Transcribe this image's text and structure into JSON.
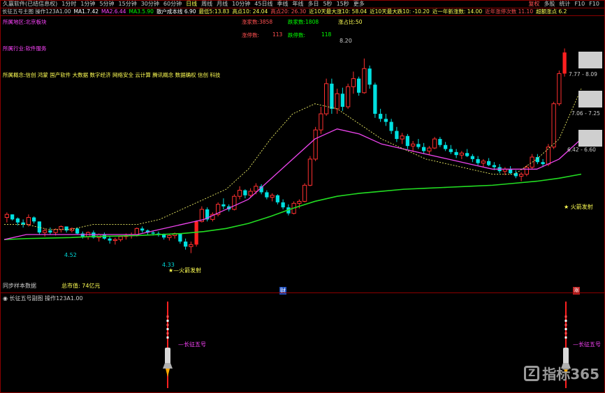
{
  "app": {
    "title": "久赢软件(已结信息权)"
  },
  "toolbar": {
    "periods": [
      "1分时",
      "1分钟",
      "5分钟",
      "15分钟",
      "30分钟",
      "60分钟",
      "日线",
      "周线",
      "月线",
      "10分钟",
      "45日线",
      "季线",
      "年线",
      "多日",
      "5秒",
      "15秒",
      "更多"
    ],
    "active_index": 6,
    "right_items": [
      "复权",
      "多股",
      "统计",
      "F10",
      "F10"
    ]
  },
  "info": {
    "items": [
      {
        "text": "长征五号主图  操作123A1.00",
        "color": "#cccccc"
      },
      {
        "text": "MA1.7.42",
        "color": "#ffffff"
      },
      {
        "text": "MA2.6.44",
        "color": "#ff44ff"
      },
      {
        "text": "MA3.5.90",
        "color": "#00ff00"
      },
      {
        "text": "散户成本线 6.90",
        "color": "#ffffff"
      },
      {
        "text": "最低5:13.83",
        "color": "#ffff54"
      },
      {
        "text": "高点10: 24.04",
        "color": "#ffff54"
      },
      {
        "text": "高点20: 26.30",
        "color": "#ff5050"
      },
      {
        "text": "近10天最大涨10: 58.04",
        "color": "#ffff54"
      },
      {
        "text": "近10天最大跌10: -10.20",
        "color": "#ffff54"
      },
      {
        "text": "近一年新涨数: 14.00",
        "color": "#ffff54"
      },
      {
        "text": "近年涨停次数 11.10",
        "color": "#ff5050"
      },
      {
        "text": "超额涨点 6.2",
        "color": "#ffff54"
      }
    ]
  },
  "left_labels": [
    {
      "text": "所属地区:北京板块",
      "color": "#ff44ff"
    },
    {
      "text": "所属行业:软件服务",
      "color": "#ff44ff"
    },
    {
      "text": "所属概念:信创 鸿蒙 国产软件 大数据 数字经济 网络安全 云计算 腾讯概念 数据确权 信创 科技",
      "color": "#ffff54"
    }
  ],
  "stats": [
    {
      "text": "涨家数:3858",
      "color": "#ff5050"
    },
    {
      "text": "跌家数:1808",
      "color": "#00ff00"
    },
    {
      "text": "涨占比:50",
      "color": "#ffff54"
    },
    {
      "text": "涨停数:",
      "color": "#ff5050"
    },
    {
      "text": "113",
      "color": "#ff5050"
    },
    {
      "text": "跌停数:",
      "color": "#00ff00"
    },
    {
      "text": "118",
      "color": "#00ff00"
    }
  ],
  "annotations": {
    "high": "8.20",
    "low_left": "4.52",
    "low_mid": "4.33",
    "rocket_left": "火箭发射",
    "rocket_right": "火箭发射",
    "bottom_left": "同步样本数据",
    "bottom_mid": "总市值: 74亿元",
    "marker_mid": "财",
    "marker_right": "涨"
  },
  "price_boxes": [
    {
      "label": "7.77 - 8.09"
    },
    {
      "label": "7.06 - 7.25"
    },
    {
      "label": "6.42 - 6.60"
    }
  ],
  "subchart": {
    "title": "长征五号副图  操作123A1.00",
    "signal_label": "长征五号"
  },
  "logo": {
    "text": "指标365"
  },
  "chart_data": {
    "type": "candlestick",
    "ylim": [
      4.2,
      8.6
    ],
    "candles": [
      [
        5.04,
        5.14,
        4.94,
        5.1
      ],
      [
        5.1,
        5.1,
        4.98,
        5.0
      ],
      [
        5.02,
        5.04,
        4.88,
        4.94
      ],
      [
        4.94,
        5.0,
        4.84,
        4.9
      ],
      [
        4.9,
        5.1,
        4.86,
        5.04
      ],
      [
        5.04,
        5.06,
        4.92,
        4.96
      ],
      [
        4.96,
        4.96,
        4.7,
        4.74
      ],
      [
        4.74,
        4.82,
        4.66,
        4.78
      ],
      [
        4.78,
        4.84,
        4.7,
        4.74
      ],
      [
        4.74,
        4.82,
        4.68,
        4.8
      ],
      [
        4.8,
        4.88,
        4.74,
        4.86
      ],
      [
        4.86,
        4.86,
        4.74,
        4.78
      ],
      [
        4.78,
        4.84,
        4.74,
        4.82
      ],
      [
        4.82,
        4.84,
        4.7,
        4.72
      ],
      [
        4.72,
        4.76,
        4.62,
        4.66
      ],
      [
        4.66,
        4.76,
        4.6,
        4.74
      ],
      [
        4.74,
        4.78,
        4.62,
        4.64
      ],
      [
        4.64,
        4.72,
        4.56,
        4.7
      ],
      [
        4.7,
        4.74,
        4.6,
        4.62
      ],
      [
        4.62,
        4.66,
        4.52,
        4.58
      ],
      [
        4.58,
        4.64,
        4.5,
        4.6
      ],
      [
        4.6,
        4.68,
        4.56,
        4.66
      ],
      [
        4.66,
        4.72,
        4.6,
        4.68
      ],
      [
        4.68,
        4.74,
        4.62,
        4.7
      ],
      [
        4.7,
        4.84,
        4.66,
        4.82
      ],
      [
        4.82,
        4.86,
        4.74,
        4.78
      ],
      [
        4.78,
        4.8,
        4.7,
        4.74
      ],
      [
        4.74,
        4.78,
        4.68,
        4.72
      ],
      [
        4.72,
        4.76,
        4.66,
        4.7
      ],
      [
        4.7,
        4.72,
        4.6,
        4.64
      ],
      [
        4.64,
        4.7,
        4.58,
        4.68
      ],
      [
        4.68,
        4.74,
        4.62,
        4.72
      ],
      [
        4.72,
        4.72,
        4.52,
        4.56
      ],
      [
        4.56,
        4.62,
        4.4,
        4.46
      ],
      [
        4.46,
        4.56,
        4.33,
        4.5
      ],
      [
        4.5,
        4.98,
        4.46,
        4.96
      ],
      [
        4.96,
        5.26,
        4.94,
        5.2
      ],
      [
        5.2,
        5.24,
        4.96,
        5.0
      ],
      [
        5.0,
        5.14,
        4.96,
        5.1
      ],
      [
        5.1,
        5.34,
        5.06,
        5.3
      ],
      [
        5.3,
        5.42,
        5.2,
        5.26
      ],
      [
        5.26,
        5.3,
        5.16,
        5.2
      ],
      [
        5.2,
        5.5,
        5.18,
        5.46
      ],
      [
        5.46,
        5.66,
        5.4,
        5.58
      ],
      [
        5.58,
        5.6,
        5.42,
        5.48
      ],
      [
        5.48,
        5.62,
        5.44,
        5.56
      ],
      [
        5.56,
        5.72,
        5.5,
        5.66
      ],
      [
        5.66,
        5.7,
        5.5,
        5.54
      ],
      [
        5.54,
        5.58,
        5.4,
        5.44
      ],
      [
        5.44,
        5.52,
        5.36,
        5.48
      ],
      [
        5.48,
        5.5,
        5.3,
        5.34
      ],
      [
        5.34,
        5.4,
        5.2,
        5.24
      ],
      [
        5.24,
        5.3,
        5.08,
        5.12
      ],
      [
        5.12,
        5.36,
        5.1,
        5.32
      ],
      [
        5.32,
        5.4,
        5.22,
        5.36
      ],
      [
        5.36,
        5.72,
        5.34,
        5.68
      ],
      [
        5.68,
        6.26,
        5.66,
        6.2
      ],
      [
        6.2,
        6.84,
        6.16,
        6.78
      ],
      [
        6.78,
        7.24,
        6.7,
        7.1
      ],
      [
        7.1,
        7.8,
        7.06,
        7.7
      ],
      [
        7.7,
        7.8,
        7.1,
        7.2
      ],
      [
        7.2,
        7.6,
        7.1,
        7.5
      ],
      [
        7.5,
        7.62,
        7.16,
        7.24
      ],
      [
        7.24,
        7.7,
        7.2,
        7.64
      ],
      [
        7.64,
        7.94,
        7.5,
        7.8
      ],
      [
        7.8,
        7.84,
        7.46,
        7.52
      ],
      [
        7.52,
        8.2,
        7.5,
        8.0
      ],
      [
        8.0,
        8.06,
        7.6,
        7.68
      ],
      [
        7.68,
        7.72,
        7.02,
        7.1
      ],
      [
        7.1,
        7.2,
        6.94,
        7.0
      ],
      [
        7.0,
        7.1,
        6.86,
        6.94
      ],
      [
        6.94,
        7.0,
        6.7,
        6.76
      ],
      [
        6.76,
        6.84,
        6.54,
        6.6
      ],
      [
        6.6,
        6.72,
        6.5,
        6.66
      ],
      [
        6.66,
        6.7,
        6.4,
        6.46
      ],
      [
        6.46,
        6.56,
        6.34,
        6.5
      ],
      [
        6.5,
        6.6,
        6.4,
        6.44
      ],
      [
        6.44,
        6.52,
        6.3,
        6.36
      ],
      [
        6.36,
        6.46,
        6.28,
        6.42
      ],
      [
        6.42,
        6.64,
        6.4,
        6.6
      ],
      [
        6.6,
        6.64,
        6.44,
        6.48
      ],
      [
        6.48,
        6.54,
        6.36,
        6.4
      ],
      [
        6.4,
        6.48,
        6.3,
        6.34
      ],
      [
        6.34,
        6.4,
        6.22,
        6.28
      ],
      [
        6.28,
        6.36,
        6.2,
        6.32
      ],
      [
        6.32,
        6.4,
        6.24,
        6.26
      ],
      [
        6.26,
        6.3,
        6.14,
        6.2
      ],
      [
        6.2,
        6.26,
        6.08,
        6.12
      ],
      [
        6.12,
        6.2,
        6.04,
        6.16
      ],
      [
        6.16,
        6.22,
        6.06,
        6.08
      ],
      [
        6.08,
        6.14,
        5.98,
        6.04
      ],
      [
        6.04,
        6.1,
        5.92,
        5.96
      ],
      [
        5.96,
        6.04,
        5.88,
        6.0
      ],
      [
        6.0,
        6.06,
        5.9,
        5.92
      ],
      [
        5.92,
        5.98,
        5.82,
        5.86
      ],
      [
        5.86,
        5.94,
        5.76,
        5.9
      ],
      [
        5.9,
        6.08,
        5.86,
        6.04
      ],
      [
        6.04,
        6.3,
        6.0,
        6.24
      ],
      [
        6.24,
        6.3,
        6.1,
        6.14
      ],
      [
        6.14,
        6.2,
        6.04,
        6.1
      ],
      [
        6.1,
        6.5,
        6.06,
        6.44
      ],
      [
        6.44,
        7.34,
        6.4,
        7.3
      ],
      [
        7.3,
        7.96,
        7.26,
        7.9
      ],
      [
        7.9,
        8.4,
        7.84,
        8.32
      ]
    ],
    "ma_yellow": [
      4.9,
      4.9,
      4.8,
      4.8,
      4.9,
      4.9,
      4.9,
      5.0,
      5.2,
      5.4,
      5.6,
      6.0,
      6.6,
      7.1,
      7.3,
      7.2,
      6.9,
      6.6,
      6.4,
      6.2,
      6.1,
      6.0,
      5.9,
      5.9,
      6.2,
      6.6,
      7.6
    ],
    "ma_magenta": [
      4.6,
      4.7,
      4.7,
      4.7,
      4.7,
      4.7,
      4.7,
      4.8,
      4.9,
      5.0,
      5.2,
      5.4,
      5.8,
      6.2,
      6.6,
      6.8,
      6.7,
      6.5,
      6.4,
      6.3,
      6.2,
      6.1,
      6.0,
      6.0,
      6.0,
      6.2,
      6.6
    ],
    "ma_green": [
      4.6,
      4.62,
      4.63,
      4.64,
      4.66,
      4.67,
      4.68,
      4.7,
      4.72,
      4.76,
      4.82,
      4.92,
      5.06,
      5.22,
      5.36,
      5.46,
      5.52,
      5.56,
      5.6,
      5.62,
      5.64,
      5.66,
      5.68,
      5.72,
      5.76,
      5.82,
      5.9
    ]
  }
}
